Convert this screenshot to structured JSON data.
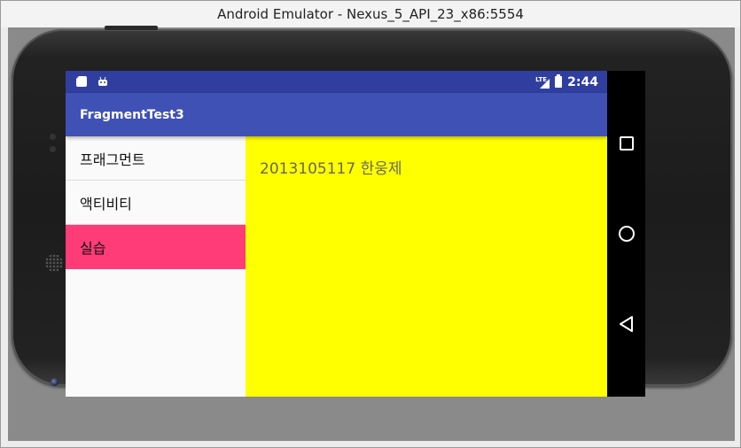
{
  "window": {
    "title": "Android Emulator - Nexus_5_API_23_x86:5554"
  },
  "status_bar": {
    "network_label": "LTE",
    "time": "2:44",
    "color": "#303f9f"
  },
  "app_bar": {
    "title": "FragmentTest3",
    "color": "#3f51b5"
  },
  "menu": {
    "items": [
      {
        "label": "프래그먼트",
        "selected": false
      },
      {
        "label": "액티비티",
        "selected": false
      },
      {
        "label": "실습",
        "selected": true
      }
    ],
    "selected_color": "#ff3b78"
  },
  "content": {
    "text": "2013105117 한웅제",
    "background": "#ffff00"
  },
  "nav_bar": {
    "buttons": [
      "recents-icon",
      "home-icon",
      "back-icon"
    ]
  }
}
